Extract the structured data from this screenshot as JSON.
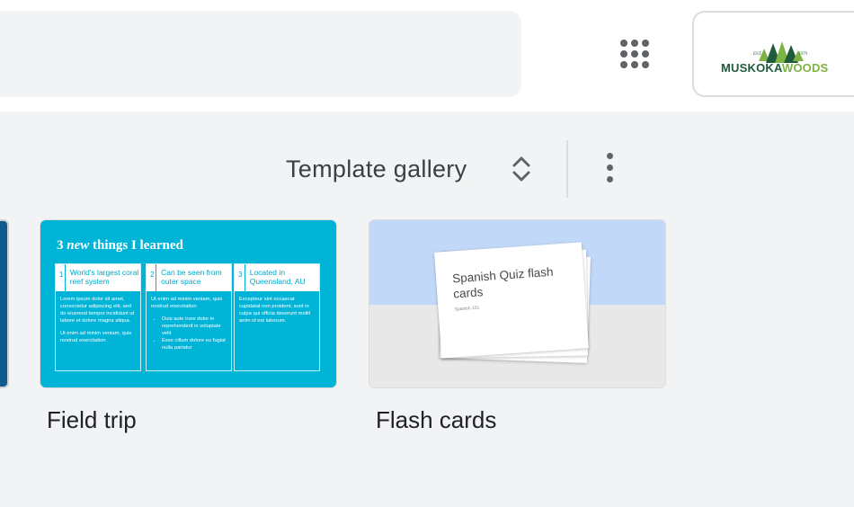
{
  "header": {
    "apps_icon": "apps-grid-icon",
    "account_logo": {
      "text_a": "MUSKOKA",
      "text_b": "WOODS",
      "est": "EST.",
      "year": "1979",
      "colors": {
        "dark_green": "#1f5a3a",
        "light_green": "#7cb342"
      }
    }
  },
  "gallery": {
    "title": "Template gallery",
    "expand_icon": "unfold-icon",
    "more_icon": "more-vertical-icon"
  },
  "templates": [
    {
      "label": "Field trip",
      "thumbnail": {
        "heading_pre": "3 ",
        "heading_em": "new",
        "heading_post": " things I learned",
        "columns": [
          {
            "num": "1",
            "title": "World's largest coral reef system",
            "body": [
              "Lorem ipsum dolor sit amet, consectetur adipiscing elit, sed do eiusmod tempor incididunt ut labore et dolore magna aliqua.",
              "Ut enim ad minim veniam, quis nostrud exercitation"
            ]
          },
          {
            "num": "2",
            "title": "Can be seen from outer space",
            "body": [
              "Ut enim ad minim veniam, quis nostrud exercitation"
            ],
            "bullets": [
              "Duis aute irure dolor in reprehenderit in voluptate velit",
              "Esse cillum dolore eu fugiat nulla pariatur"
            ]
          },
          {
            "num": "3",
            "title": "Located in Queensland, AU",
            "body": [
              "Excepteur sint occaecat cupidatat non proident, sunt in culpa qui officia deserunt mollit anim id est laborum."
            ]
          }
        ]
      }
    },
    {
      "label": "Flash cards",
      "thumbnail": {
        "card_title": "Spanish Quiz flash cards",
        "card_sub": "Spanish 101"
      }
    }
  ]
}
